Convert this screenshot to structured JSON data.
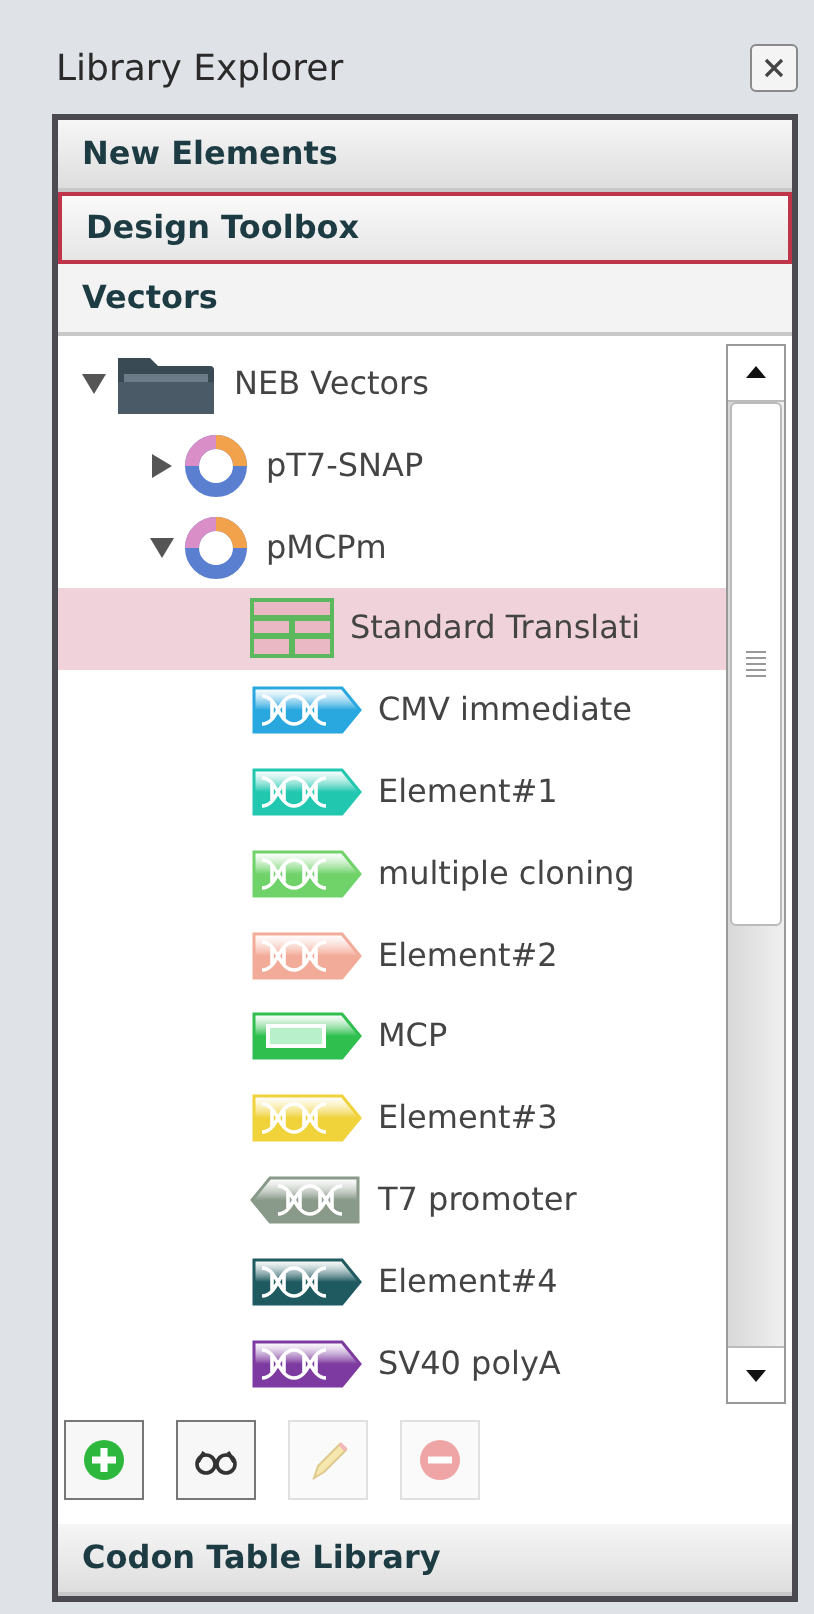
{
  "window": {
    "title": "Library Explorer"
  },
  "sections": [
    {
      "label": "New Elements",
      "expanded": false,
      "highlighted": false
    },
    {
      "label": "Design Toolbox",
      "expanded": false,
      "highlighted": true
    },
    {
      "label": "Vectors",
      "expanded": true,
      "highlighted": false
    },
    {
      "label": "Codon Table Library",
      "expanded": false,
      "highlighted": false
    }
  ],
  "tree": [
    {
      "kind": "folder",
      "label": "NEB Vectors",
      "expanded": true,
      "selected": false,
      "children": [
        {
          "kind": "vector",
          "label": "pT7-SNAP",
          "expanded": false,
          "selected": false
        },
        {
          "kind": "vector",
          "label": "pMCPm",
          "expanded": true,
          "selected": false,
          "children": [
            {
              "kind": "table",
              "label": "Standard Translati",
              "selected": true
            },
            {
              "kind": "feature",
              "label": "CMV immediate",
              "color": "#29a8e0",
              "selected": false
            },
            {
              "kind": "feature",
              "label": "Element#1",
              "color": "#22c7b0",
              "selected": false
            },
            {
              "kind": "feature",
              "label": "multiple cloning",
              "color": "#6fd36a",
              "selected": false
            },
            {
              "kind": "feature",
              "label": "Element#2",
              "color": "#f2ab98",
              "selected": false
            },
            {
              "kind": "cds",
              "label": "MCP",
              "color": "#2fbf4f",
              "selected": false
            },
            {
              "kind": "feature",
              "label": "Element#3",
              "color": "#f0d23a",
              "selected": false
            },
            {
              "kind": "reverse_feature",
              "label": "T7 promoter",
              "color": "#8a9a8a",
              "selected": false
            },
            {
              "kind": "feature",
              "label": "Element#4",
              "color": "#1e5a60",
              "selected": false
            },
            {
              "kind": "feature",
              "label": "SV40 polyA",
              "color": "#7d3aa0",
              "selected": false
            }
          ]
        }
      ]
    }
  ],
  "toolbar": [
    {
      "kind": "add",
      "disabled": false
    },
    {
      "kind": "view",
      "disabled": false
    },
    {
      "kind": "edit",
      "disabled": true
    },
    {
      "kind": "remove",
      "disabled": true
    }
  ]
}
